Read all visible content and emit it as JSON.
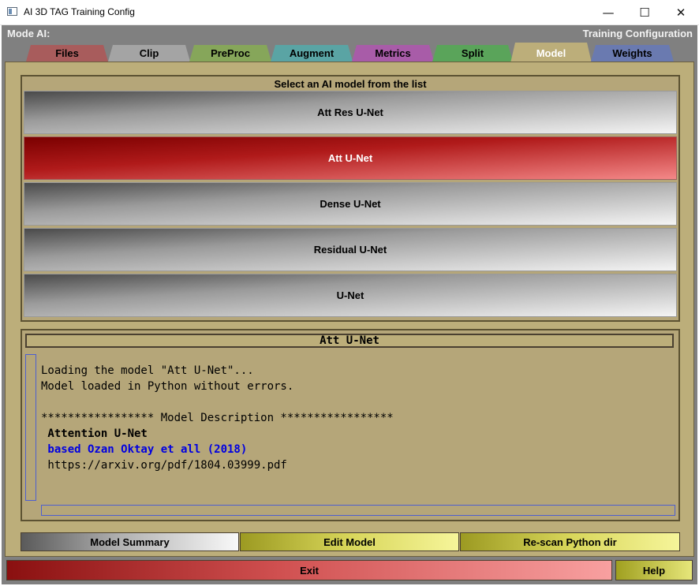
{
  "window": {
    "title": "AI 3D TAG Training Config",
    "minimize": "—",
    "maximize": "☐",
    "close": "✕"
  },
  "header": {
    "mode_label": "Mode AI:",
    "config_label": "Training Configuration"
  },
  "tabs": [
    {
      "label": "Files",
      "color": "#a85c5c"
    },
    {
      "label": "Clip",
      "color": "#a4a4a4"
    },
    {
      "label": "PreProc",
      "color": "#86a65a"
    },
    {
      "label": "Augment",
      "color": "#5aa4a4"
    },
    {
      "label": "Metrics",
      "color": "#a85ca8"
    },
    {
      "label": "Split",
      "color": "#5aa45a"
    },
    {
      "label": "Model",
      "color": "#bcae7a",
      "active": true
    },
    {
      "label": "Weights",
      "color": "#6a7ab0"
    }
  ],
  "model_list": {
    "title": "Select an AI model from the list",
    "items": [
      "Att Res U-Net",
      "Att U-Net",
      "Dense U-Net",
      "Residual U-Net",
      "U-Net"
    ],
    "selected": "Att U-Net"
  },
  "info": {
    "header": "Att U-Net",
    "lines": {
      "l1": "Loading the model \"Att U-Net\"...",
      "l2": "Model loaded in Python without errors.",
      "l3": "***************** Model Description *****************",
      "l4": " Attention U-Net",
      "l5": " based Ozan Oktay et all (2018)",
      "l6": " https://arxiv.org/pdf/1804.03999.pdf"
    }
  },
  "actions": {
    "summary": "Model Summary",
    "edit": "Edit Model",
    "rescan": "Re-scan Python dir"
  },
  "footer": {
    "exit": "Exit",
    "help": "Help"
  }
}
